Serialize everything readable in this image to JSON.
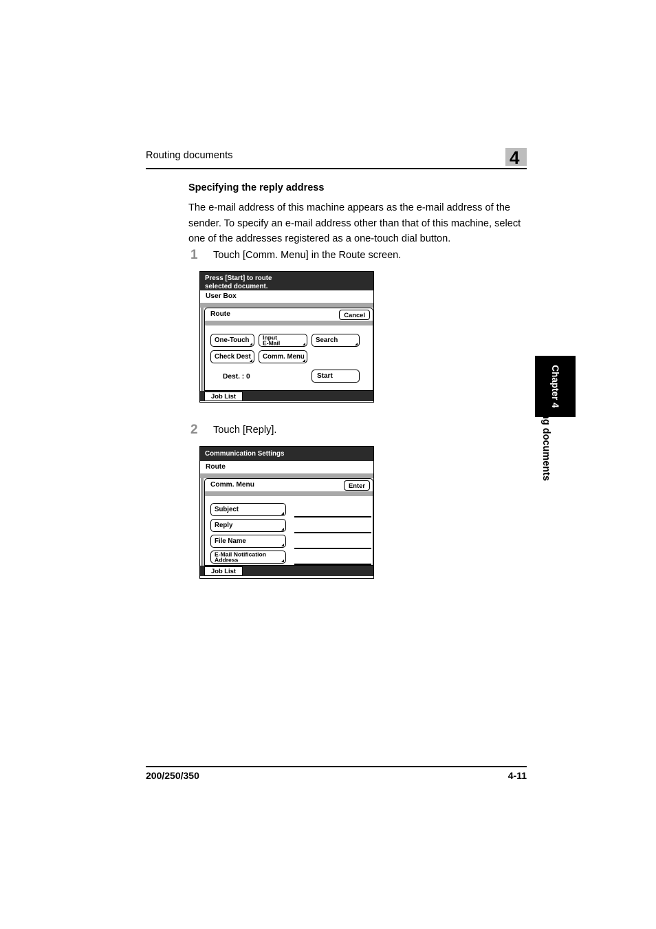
{
  "header": {
    "running_title": "Routing documents",
    "chapter_number": "4"
  },
  "content": {
    "section_heading": "Specifying the reply address",
    "intro_paragraph": "The e-mail address of this machine appears as the e-mail address of the sender. To specify an e-mail address other than that of this machine, select one of the addresses registered as a one-touch dial button."
  },
  "steps": [
    {
      "number": "1",
      "text": "Touch [Comm. Menu] in the Route screen."
    },
    {
      "number": "2",
      "text": "Touch [Reply]."
    }
  ],
  "panel1": {
    "title": "Press [Start] to route\nselected document.",
    "title_line1": "Press [Start] to route",
    "title_line2": "selected document.",
    "subbar": "User Box",
    "tab_label": "Route",
    "tab_button": "Cancel",
    "buttons": {
      "one_touch": "One-Touch",
      "input_email_line1": "Input",
      "input_email_line2": "E-Mail",
      "search": "Search",
      "check_dest": "Check Dest",
      "comm_menu": "Comm. Menu"
    },
    "dest_label": "Dest.  :   0",
    "start_button": "Start",
    "footer_button": "Job List"
  },
  "panel2": {
    "title": "Communication Settings",
    "subbar": "Route",
    "tab_label": "Comm. Menu",
    "tab_button": "Enter",
    "rows": [
      {
        "label": "Subject",
        "value": ""
      },
      {
        "label": "Reply",
        "value": ""
      },
      {
        "label": "File Name",
        "value": ""
      },
      {
        "label_line1": "E-Mail Notification",
        "label_line2": "Address",
        "value": ""
      }
    ],
    "row_labels": [
      "Subject",
      "Reply",
      "File Name"
    ],
    "row4_line1": "E-Mail Notification",
    "row4_line2": "Address",
    "footer_button": "Job List"
  },
  "side_tabs": {
    "chapter_tab": "Chapter 4",
    "running_title": "Routing documents"
  },
  "footer": {
    "model": "200/250/350",
    "page": "4-11"
  },
  "colors": {
    "panel_header_bg": "#2b2b2b",
    "panel_gray_band": "#a8a8a8",
    "chapter_badge_bg": "#bdbdbd",
    "step_number": "#8c8c8c",
    "thumb_tab_bg": "#000000"
  }
}
